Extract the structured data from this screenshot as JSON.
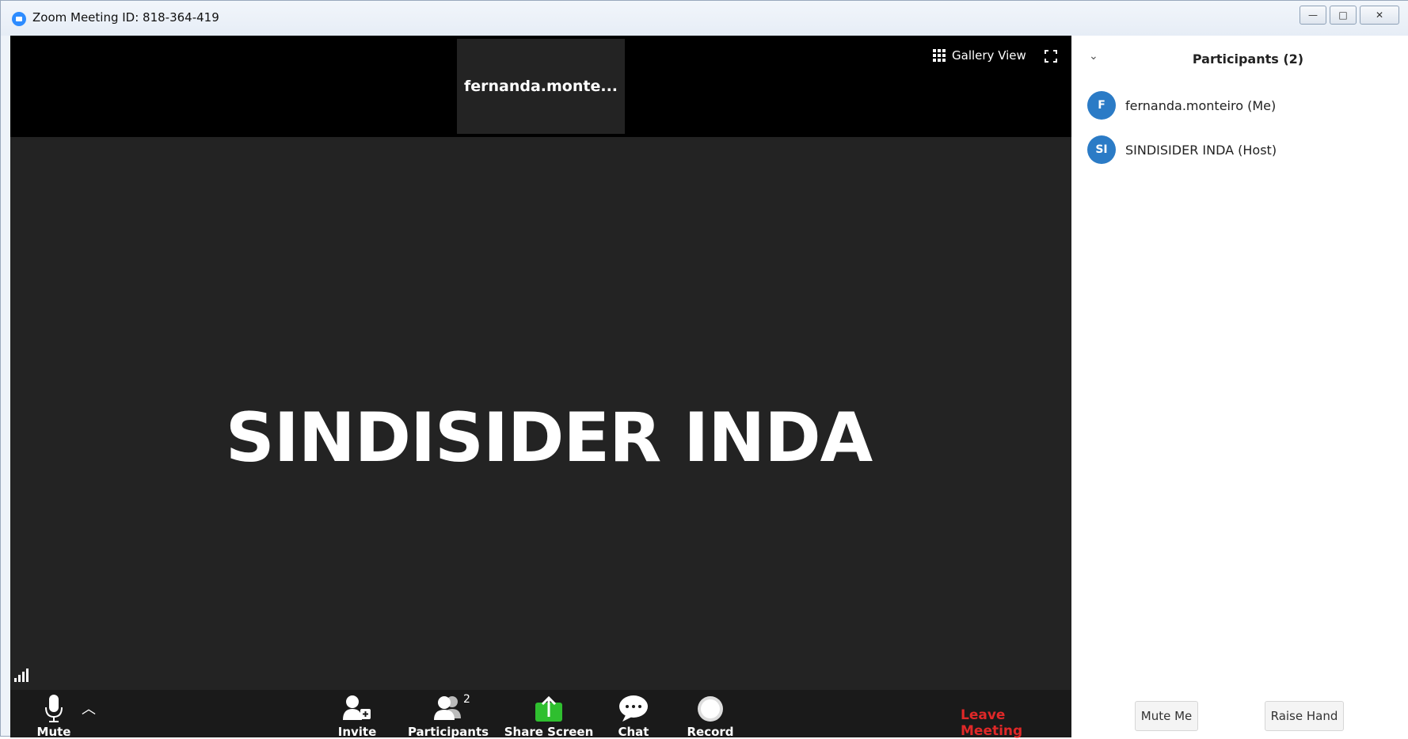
{
  "window": {
    "title": "Zoom Meeting ID: 818-364-419",
    "controls": {
      "minimize": "—",
      "maximize": "□",
      "close": "✕"
    }
  },
  "video": {
    "thumbnail_name": "fernanda.monte...",
    "gallery_view_label": "Gallery View",
    "speaker_name": "SINDISIDER INDA"
  },
  "toolbar": {
    "mute_label": "Mute",
    "invite_label": "Invite",
    "participants_label": "Participants",
    "participants_count": "2",
    "share_screen_label": "Share Screen",
    "chat_label": "Chat",
    "record_label": "Record",
    "leave_label": "Leave Meeting",
    "colors": {
      "leave": "#e02828",
      "share": "#2fbf2f"
    }
  },
  "panel": {
    "title": "Participants (2)",
    "participants": [
      {
        "initials": "F",
        "name": "fernanda.monteiro (Me)"
      },
      {
        "initials": "SI",
        "name": "SINDISIDER INDA (Host)"
      }
    ],
    "mute_me_label": "Mute Me",
    "raise_hand_label": "Raise Hand"
  }
}
